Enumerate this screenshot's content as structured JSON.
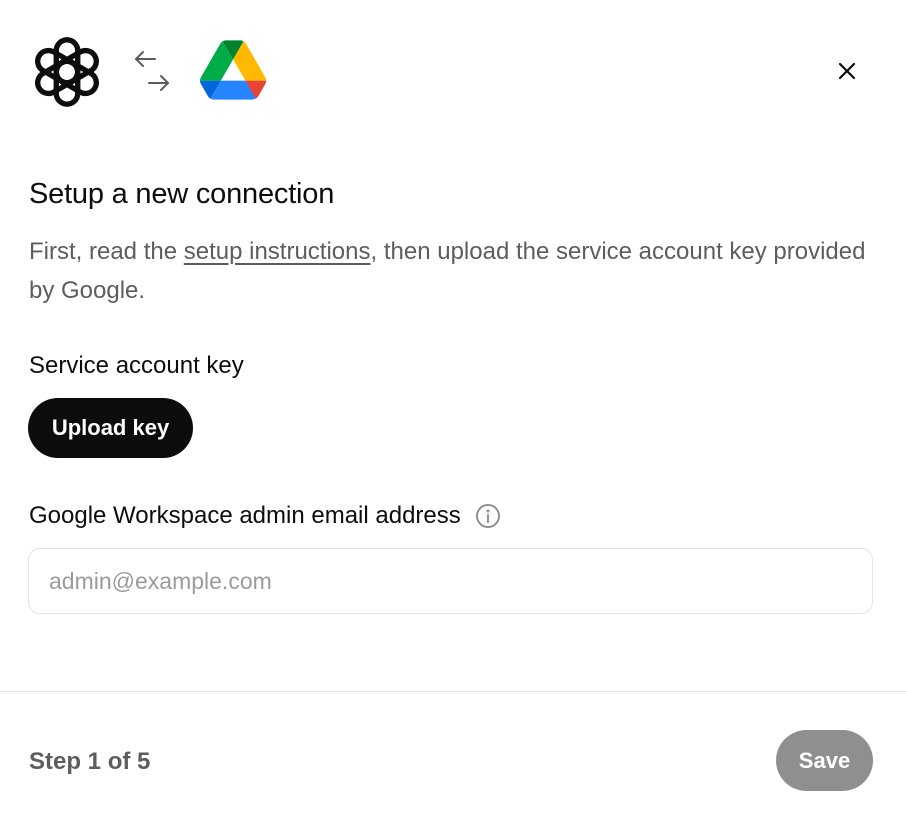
{
  "header": {
    "app_logo": "openai-logo",
    "connector_logo": "google-drive-logo",
    "swap_icon": "arrows-swap-icon",
    "close_icon": "close-icon"
  },
  "title": "Setup a new connection",
  "description": {
    "before_link": "First, read the ",
    "link_text": "setup instructions",
    "after_link": ", then upload the service account key provided by Google."
  },
  "service_key": {
    "label": "Service account key",
    "upload_button": "Upload key"
  },
  "admin_email": {
    "label": "Google Workspace admin email address",
    "info_icon": "info-icon",
    "placeholder": "admin@example.com",
    "value": ""
  },
  "footer": {
    "step_text": "Step 1 of 5",
    "save_button": "Save"
  },
  "colors": {
    "primary_button": "#0d0d0d",
    "disabled_button": "#8f8f8f",
    "secondary_text": "#5d5d5d",
    "drive_green": "#0f9d58",
    "drive_yellow": "#f4b400",
    "drive_blue": "#4285f4",
    "drive_red": "#ea4335"
  }
}
